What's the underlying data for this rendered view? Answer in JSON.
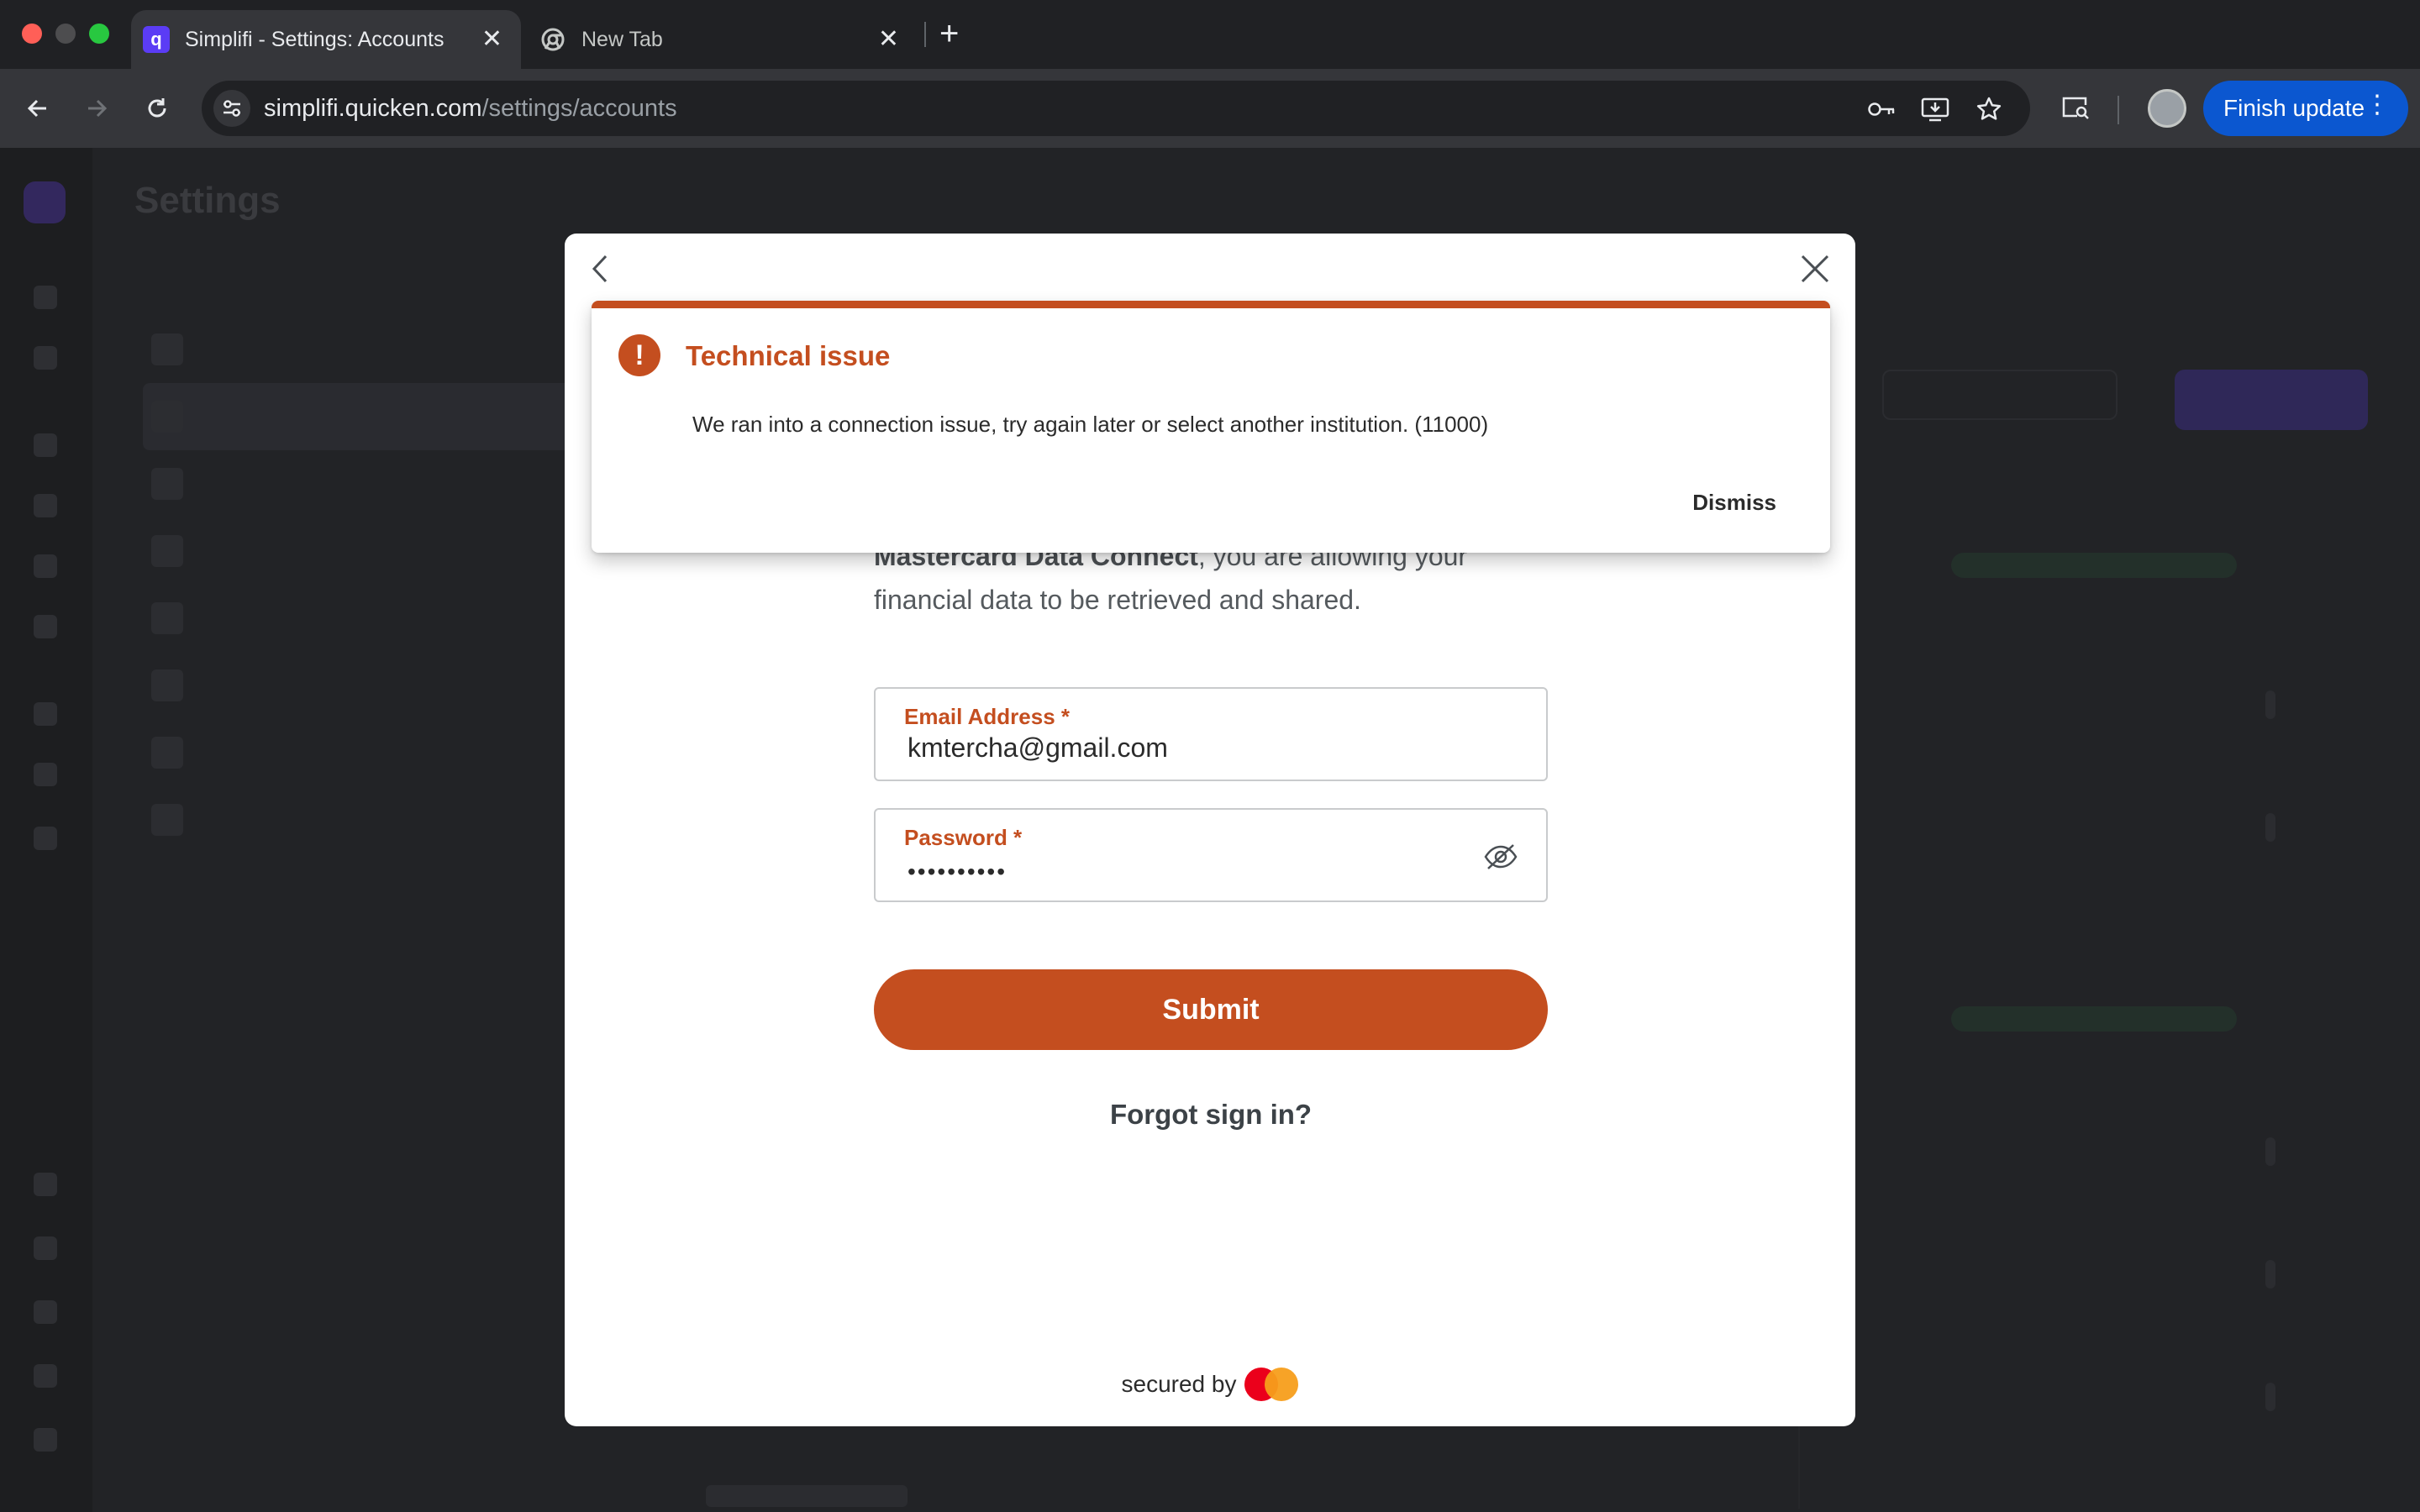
{
  "browser": {
    "tabs": [
      {
        "title": "Simplifi - Settings: Accounts",
        "favicon": "quicken-q-icon",
        "active": true
      },
      {
        "title": "New Tab",
        "favicon": "chrome-icon",
        "active": false
      }
    ],
    "url_host": "simplifi.quicken.com",
    "url_path": "/settings/accounts",
    "update_button": "Finish update",
    "colors": {
      "update": "#0b57d0",
      "tab_active": "#35363a"
    }
  },
  "app": {
    "page_title": "Settings"
  },
  "modal": {
    "alert": {
      "title": "Technical issue",
      "message": "We ran into a connection issue, try again later or select another institution. (11000)",
      "dismiss_label": "Dismiss",
      "color": "#c44e1f"
    },
    "consent": {
      "bold_part": "Mastercard Data Connect",
      "text_part": ", you are allowing your financial data to be retrieved and shared."
    },
    "email": {
      "label": "Email Address *",
      "value": "kmtercha@gmail.com"
    },
    "password": {
      "label": "Password *",
      "masked_value": "••••••••••"
    },
    "submit_label": "Submit",
    "forgot_label": "Forgot sign in?",
    "secured_by": "secured by",
    "accent_color": "#c44e1f"
  }
}
